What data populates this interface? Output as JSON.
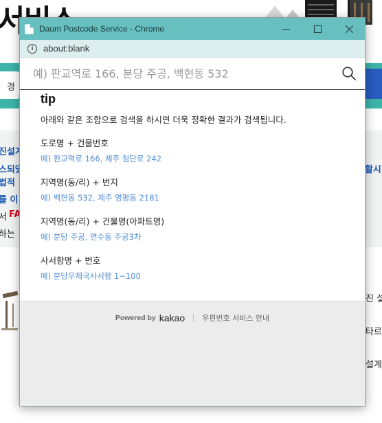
{
  "background": {
    "title": "서비스",
    "search_fragment": "경",
    "left_lines": [
      "진설계",
      "스되었",
      "법적 ",
      "를 이",
      "서 ",
      "하는 "
    ],
    "red_fragment": "FA",
    "right_top": "활시",
    "right_lines": [
      "진 설",
      "타르(",
      "설계"
    ]
  },
  "popup": {
    "window_title": "Daum Postcode Service - Chrome",
    "address": "about:blank",
    "search": {
      "placeholder": "예) 판교역로 166, 분당 주공, 백현동 532"
    },
    "tip": {
      "heading": "tip",
      "description": "아래와 같은 조합으로 검색을 하시면 더욱 정확한 결과가 검색됩니다.",
      "items": [
        {
          "label": "도로명 + 건물번호",
          "example": "예) 판교역로 166,  제주 첨단로 242"
        },
        {
          "label": "지역명(동/리) + 번지",
          "example": "예) 백현동 532,  제주 영평동 2181"
        },
        {
          "label": "지역명(동/리) + 건물명(아파트명)",
          "example": "예) 분당 주공,  연수동 주공3차"
        },
        {
          "label": "사서함명 + 번호",
          "example": "예) 분당우체국사서함 1~100"
        }
      ]
    },
    "footer": {
      "powered_by": "Powered by",
      "brand": "kakao",
      "notice": "우편번호 서비스 안내"
    }
  },
  "icons": {
    "favicon": "document-icon",
    "info": "info-icon",
    "search": "search-icon",
    "minimize": "minimize-icon",
    "maximize": "maximize-icon",
    "close": "close-icon"
  },
  "colors": {
    "titlebar": "#67bfbf",
    "address_bar": "#dceeee",
    "background_search_bar": "#3cb4a8",
    "example_text": "#4f8bd2",
    "footer_bg": "#ececec"
  }
}
